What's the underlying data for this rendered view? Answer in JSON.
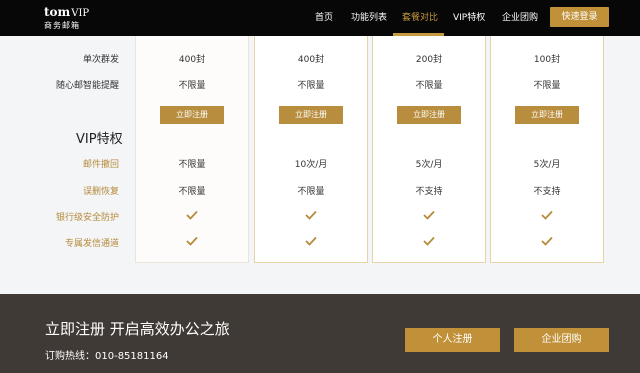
{
  "header": {
    "logo_main": "tom",
    "logo_vip": "VIP",
    "logo_sub": "商务邮箱",
    "nav": [
      "首页",
      "功能列表",
      "套餐对比",
      "VIP特权",
      "企业团购"
    ],
    "login_label": "快速登录",
    "colors": {
      "background": "#070707",
      "accent": "#c79a3f"
    }
  },
  "plans": {
    "rows": {
      "mass_mail": {
        "label": "单次群发",
        "values": [
          "400封",
          "400封",
          "200封",
          "100封"
        ]
      },
      "reminder": {
        "label": "随心邮智能提醒",
        "values": [
          "不限量",
          "不限量",
          "不限量",
          "不限量"
        ]
      }
    },
    "register_label": "立即注册",
    "vip_section_title": "VIP特权",
    "vip_rows": {
      "recall": {
        "label": "邮件撤回",
        "values": [
          "不限量",
          "10次/月",
          "5次/月",
          "5次/月"
        ]
      },
      "undelete": {
        "label": "误删恢复",
        "values": [
          "不限量",
          "不限量",
          "不支持",
          "不支持"
        ]
      },
      "security": {
        "label": "银行级安全防护",
        "checks": [
          true,
          true,
          true,
          true
        ]
      },
      "channel": {
        "label": "专属发信通道",
        "checks": [
          true,
          true,
          true,
          true
        ]
      }
    },
    "icon": "checkmark-icon"
  },
  "footer": {
    "title": "立即注册 开启高效办公之旅",
    "phone": "订购热线：010-85181164",
    "personal_btn": "个人注册",
    "enterprise_btn": "企业团购",
    "colors": {
      "background": "#403a36",
      "button": "#c1913a"
    }
  }
}
